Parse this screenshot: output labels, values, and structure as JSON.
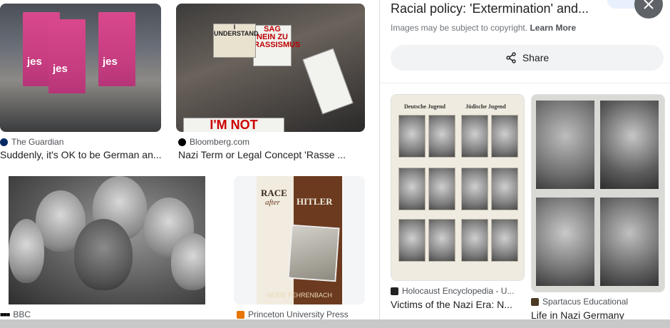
{
  "results": [
    {
      "source": "The Guardian",
      "title": "Suddenly, it's OK to be German an...",
      "banner_text": "jes"
    },
    {
      "source": "Bloomberg.com",
      "title": "Nazi Term or Legal Concept 'Rasse ...",
      "signs": [
        "SAG NEIN ZU RASSISMUS",
        "I UNDERSTAND",
        "I'M NOT"
      ]
    },
    {
      "source": "BBC",
      "title": ""
    },
    {
      "source": "Princeton University Press",
      "title": "",
      "book_title_1": "RACE",
      "book_title_2": "after",
      "book_title_3": "HITLER",
      "book_author": "HEIDE FEHRENBACH"
    }
  ],
  "panel": {
    "title": "Racial policy: 'Extermination' and...",
    "copyright_note": "Images may be subject to copyright.",
    "learn_more": "Learn More",
    "share_label": "Share",
    "close_icon": "close-icon",
    "share_icon": "share-icon"
  },
  "related": [
    {
      "source": "Holocaust Encyclopedia - U...",
      "title": "Victims of the Nazi Era: N...",
      "header_left": "Deutsche Jugend",
      "header_right": "Jüdische Jugend"
    },
    {
      "source": "Spartacus Educational",
      "title": "Life in Nazi Germany"
    }
  ],
  "colors": {
    "accent": "#1a73e8",
    "guardian": "#052962",
    "bloomberg": "#000000",
    "bbc": "#000000",
    "princeton": "#e77500"
  }
}
